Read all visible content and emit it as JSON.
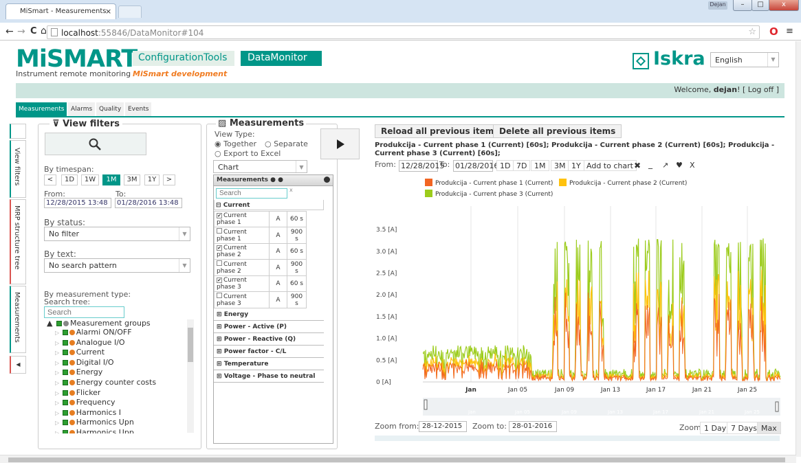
{
  "browser": {
    "tab_title": "MiSmart - Measurements",
    "tab_close": "×",
    "user_badge": "Dejan",
    "url_host": "localhost",
    "url_path": ":55846/DataMonitor#104",
    "nav": {
      "back": "←",
      "forward": "→",
      "reload": "C",
      "home": "⌂"
    }
  },
  "header": {
    "logo": "MiSMART",
    "subtitle": "Instrument remote monitoring",
    "tagline": "MiSmart development",
    "config_tools": "ConfigurationTools",
    "data_monitor": "DataMonitor",
    "brand": "Iskra",
    "language": "English"
  },
  "welcome": {
    "prefix": "Welcome, ",
    "user": "dejan",
    "suffix": "! [ Log off ]"
  },
  "main_tabs": [
    "Measurements",
    "Alarms",
    "Quality",
    "Events"
  ],
  "side_tabs": [
    "View filters",
    "MRP structure tree",
    "Measurements"
  ],
  "filters": {
    "title": "View filters",
    "by_timespan": "By timespan:",
    "timespan_buttons": [
      "<",
      "1D",
      "1W",
      "1M",
      "3M",
      "1Y",
      ">"
    ],
    "from_label": "From:",
    "to_label": "To:",
    "from": "12/28/2015 13:48",
    "to": "01/28/2016 13:48",
    "by_status": "By status:",
    "status": "No filter",
    "by_text": "By text:",
    "text_filter": "No search pattern",
    "by_type": "By measurement type:",
    "search_tree": "Search tree:",
    "search_placeholder": "Search",
    "tree_root": "Measurement groups",
    "tree": [
      "Alarmi ON/OFF",
      "Analogue I/O",
      "Current",
      "Digital I/O",
      "Energy",
      "Energy counter costs",
      "Flicker",
      "Frequency",
      "Harmonics I",
      "Harmonics Upn",
      "Harmonics Upp"
    ]
  },
  "measurements": {
    "title": "Measurements",
    "view_type": "View Type:",
    "together": "Together",
    "separate": "Separate",
    "export": "Export to Excel",
    "chart_select": "Chart",
    "table_header": "Measurements",
    "search_placeholder": "Search",
    "current_group": "Current",
    "rows": [
      {
        "name": "Current phase 1",
        "unit": "A",
        "interval": "60 s",
        "checked": true
      },
      {
        "name": "Current phase 1",
        "unit": "A",
        "interval": "900 s",
        "checked": false
      },
      {
        "name": "Current phase 2",
        "unit": "A",
        "interval": "60 s",
        "checked": true
      },
      {
        "name": "Current phase 2",
        "unit": "A",
        "interval": "900 s",
        "checked": false
      },
      {
        "name": "Current phase 3",
        "unit": "A",
        "interval": "60 s",
        "checked": true
      },
      {
        "name": "Current phase 3",
        "unit": "A",
        "interval": "900 s",
        "checked": false
      }
    ],
    "groups": [
      "Energy",
      "Power - Active (P)",
      "Power - Reactive (Q)",
      "Power factor - C/L",
      "Temperature",
      "Voltage - Phase to neutral"
    ]
  },
  "chart_panel": {
    "reload": "Reload all previous items",
    "delete": "Delete all previous items",
    "description": "Produkcija - Current phase 1 (Current) [60s]; Produkcija - Current phase 2 (Current) [60s]; Produkcija - Current phase 3 (Current) [60s];",
    "from_label": "From:",
    "from": "12/28/2015",
    "to_label": "To:",
    "to": "01/28/2016",
    "range_buttons": [
      "1D",
      "7D",
      "1M",
      "3M",
      "1Y"
    ],
    "add_to_chart": "Add to chart",
    "zoom_from_label": "Zoom from:",
    "zoom_from": "28-12-2015",
    "zoom_to_label": "Zoom to:",
    "zoom_to": "28-01-2016",
    "zoom_label": "Zoom:",
    "zoom_buttons": [
      "1 Day",
      "7 Days",
      "Max"
    ]
  },
  "chart_data": {
    "type": "line",
    "title": "",
    "y_ticks": [
      "0 [A]",
      "0.5 [A]",
      "1.0 [A]",
      "1.5 [A]",
      "2.0 [A]",
      "2.5 [A]",
      "3.0 [A]",
      "3.5 [A]"
    ],
    "x_ticks": [
      "Jan",
      "Jan 05",
      "Jan 09",
      "Jan 13",
      "Jan 17",
      "Jan 21",
      "Jan 25"
    ],
    "navigator_ticks": [
      "Jan",
      "Jan 05",
      "Jan 09",
      "Jan 13",
      "Jan 17",
      "Jan 21",
      "Jan 25"
    ],
    "ylim": [
      0,
      3.5
    ],
    "xlim": [
      "2015-12-28",
      "2016-01-28"
    ],
    "series": [
      {
        "name": "Produkcija - Current phase 1 (Current)",
        "color": "#f26522"
      },
      {
        "name": "Produkcija - Current phase 2 (Current)",
        "color": "#ffc20e"
      },
      {
        "name": "Produkcija - Current phase 3 (Current)",
        "color": "#9ccc1c"
      }
    ]
  }
}
